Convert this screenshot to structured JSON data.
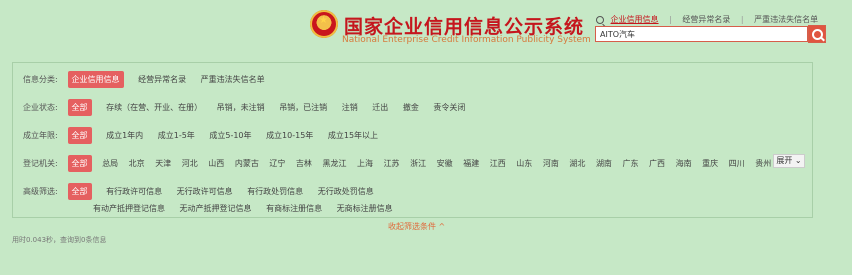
{
  "header": {
    "title": "国家企业信用信息公示系统",
    "subtitle": "National Enterprise Credit Information Publicity System"
  },
  "search": {
    "tabs": [
      "企业信用信息",
      "经营异常名录",
      "严重违法失信名单"
    ],
    "value": "AITO汽车"
  },
  "filters": {
    "info_type": {
      "label": "信息分类:",
      "options": [
        "企业信用信息",
        "经营异常名录",
        "严重违法失信名单"
      ]
    },
    "status": {
      "label": "企业状态:",
      "options": [
        "全部",
        "存续（在营、开业、在册）",
        "吊销，未注销",
        "吊销，已注销",
        "注销",
        "迁出",
        "撤金",
        "责令关闭"
      ]
    },
    "established": {
      "label": "成立年限:",
      "options": [
        "全部",
        "成立1年内",
        "成立1-5年",
        "成立5-10年",
        "成立10-15年",
        "成立15年以上"
      ]
    },
    "authority": {
      "label": "登记机关:",
      "options": [
        "全部",
        "总局",
        "北京",
        "天津",
        "河北",
        "山西",
        "内蒙古",
        "辽宁",
        "吉林",
        "黑龙江",
        "上海",
        "江苏",
        "浙江",
        "安徽",
        "福建",
        "江西",
        "山东",
        "河南",
        "湖北",
        "湖南",
        "广东",
        "广西",
        "海南",
        "重庆",
        "四川",
        "贵州"
      ],
      "expand_label": "展开"
    },
    "advanced": {
      "label": "高级筛选:",
      "options_row1": [
        "全部",
        "有行政许可信息",
        "无行政许可信息",
        "有行政处罚信息",
        "无行政处罚信息"
      ],
      "options_row2": [
        "有动产抵押登记信息",
        "无动产抵押登记信息",
        "有商标注册信息",
        "无商标注册信息"
      ]
    }
  },
  "collapse_link": "收起筛选条件 ^",
  "stats_text": "用时0.043秒，查询到0条信息"
}
